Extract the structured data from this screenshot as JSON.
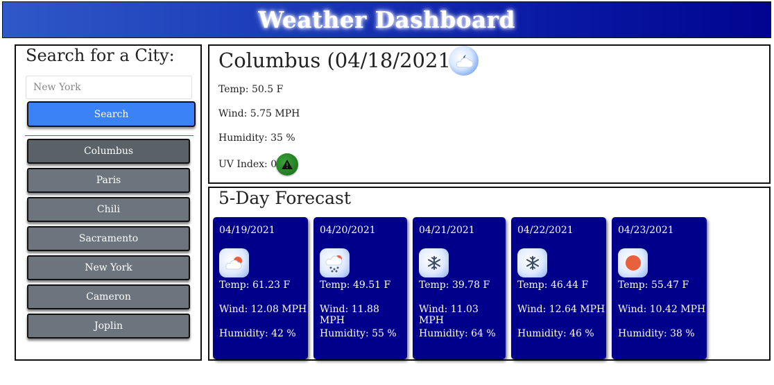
{
  "header": {
    "title": "Weather Dashboard"
  },
  "sidebar": {
    "search_title": "Search for a City:",
    "search_placeholder": "New York",
    "search_button": "Search",
    "history": [
      "Columbus",
      "Paris",
      "Chili",
      "Sacramento",
      "New York",
      "Cameron",
      "Joplin"
    ]
  },
  "current": {
    "title": "Columbus (04/18/2021)",
    "icon": "cloudy-night-icon",
    "temp": "Temp: 50.5 F",
    "wind": "Wind: 5.75 MPH",
    "humidity": "Humidity: 35 %",
    "uv_label": "UV Index: 0",
    "uv_icon": "warning-icon",
    "uv_color": "#2a8a2a"
  },
  "forecast": {
    "title": "5-Day Forecast",
    "card_color": "#00008b",
    "days": [
      {
        "date": "04/19/2021",
        "icon": "cloudy-sun-icon",
        "temp": "Temp: 61.23 F",
        "wind": "Wind: 12.08 MPH",
        "humidity": "Humidity: 42 %"
      },
      {
        "date": "04/20/2021",
        "icon": "snow-cloud-icon",
        "temp": "Temp: 49.51 F",
        "wind": "Wind: 11.88 MPH",
        "humidity": "Humidity: 55 %"
      },
      {
        "date": "04/21/2021",
        "icon": "snowflake-icon",
        "temp": "Temp: 39.78 F",
        "wind": "Wind: 11.03 MPH",
        "humidity": "Humidity: 64 %"
      },
      {
        "date": "04/22/2021",
        "icon": "snowflake-icon",
        "temp": "Temp: 46.44 F",
        "wind": "Wind: 12.64 MPH",
        "humidity": "Humidity: 46 %"
      },
      {
        "date": "04/23/2021",
        "icon": "sun-icon",
        "temp": "Temp: 55.47 F",
        "wind": "Wind: 10.42 MPH",
        "humidity": "Humidity: 38 %"
      }
    ]
  }
}
